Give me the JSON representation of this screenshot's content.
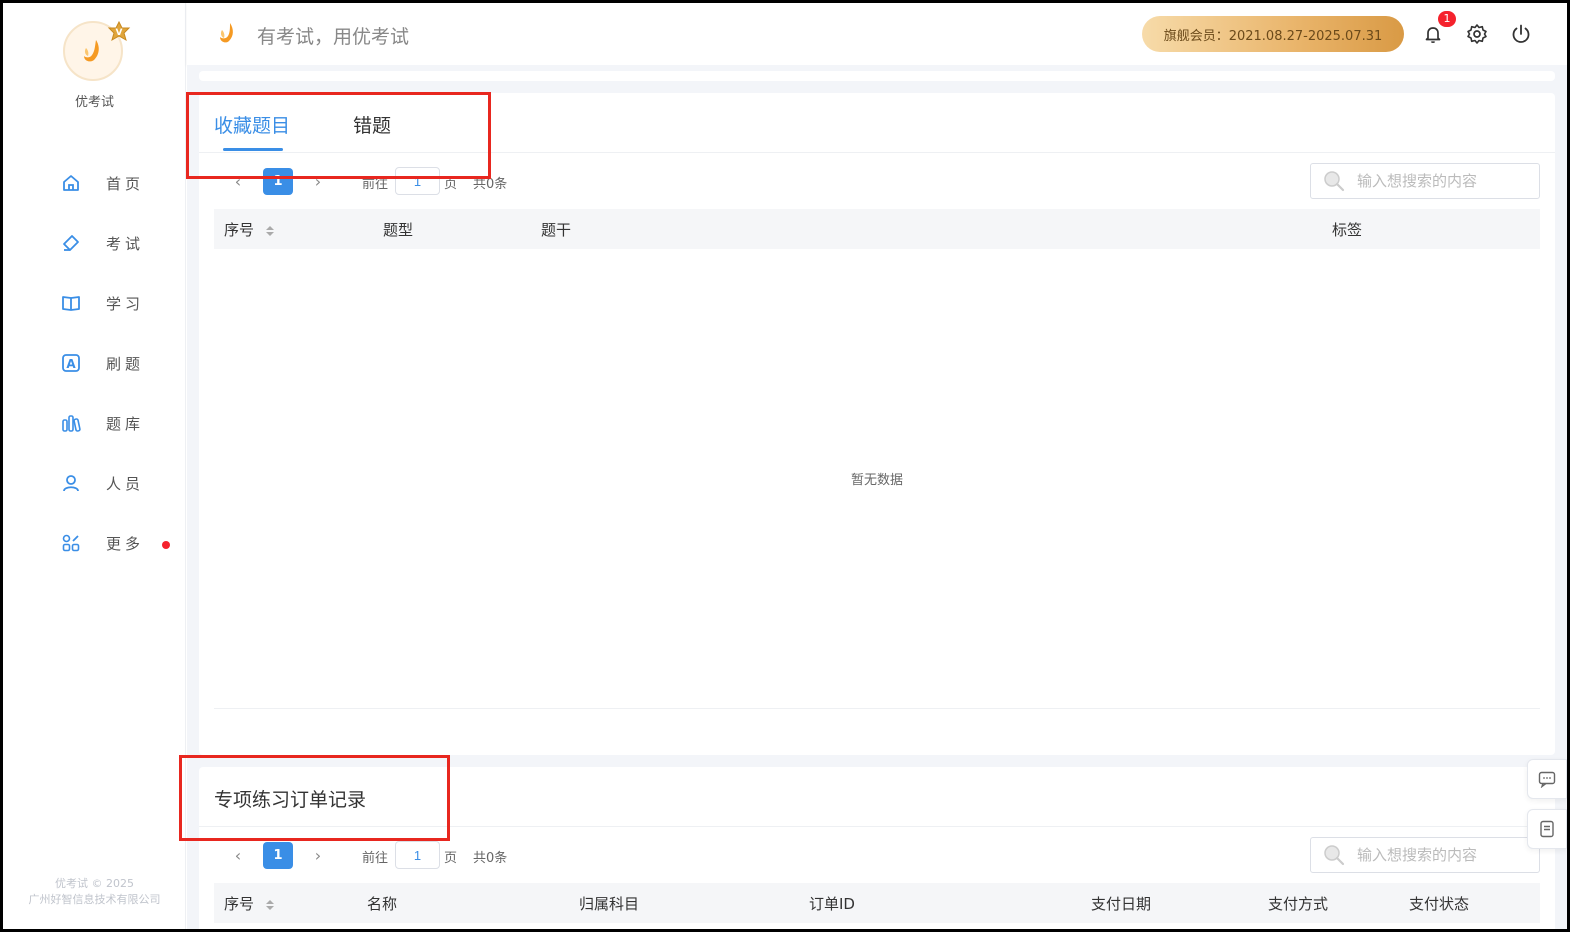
{
  "brand": {
    "name": "优考试",
    "slogan": "有考试，用优考试"
  },
  "header": {
    "member_text": "旗舰会员：2021.08.27-2025.07.31",
    "notification_count": "1"
  },
  "sidebar": {
    "items": [
      {
        "label": "首页",
        "icon": "home-icon"
      },
      {
        "label": "考试",
        "icon": "eraser-icon"
      },
      {
        "label": "学习",
        "icon": "book-icon"
      },
      {
        "label": "刷题",
        "icon": "letter-a-icon"
      },
      {
        "label": "题库",
        "icon": "bars-icon"
      },
      {
        "label": "人员",
        "icon": "user-icon"
      },
      {
        "label": "更多",
        "icon": "apps-icon"
      }
    ],
    "copyright_line1": "优考试 © 2025",
    "copyright_line2": "广州好智信息技术有限公司"
  },
  "favorites_card": {
    "tabs": [
      {
        "label": "收藏题目",
        "active": true
      },
      {
        "label": "错题",
        "active": false
      }
    ],
    "pagination": {
      "current_page": "1",
      "goto_label": "前往",
      "goto_value": "1",
      "page_unit": "页",
      "total": "共0条"
    },
    "search_placeholder": "输入想搜索的内容",
    "columns": [
      "序号",
      "题型",
      "题干",
      "标签"
    ],
    "rows": [],
    "empty_text": "暂无数据"
  },
  "orders_card": {
    "title": "专项练习订单记录",
    "pagination": {
      "current_page": "1",
      "goto_label": "前往",
      "goto_value": "1",
      "page_unit": "页",
      "total": "共0条"
    },
    "search_placeholder": "输入想搜索的内容",
    "columns": [
      "序号",
      "名称",
      "归属科目",
      "订单ID",
      "支付日期",
      "支付方式",
      "支付状态"
    ]
  },
  "colors": {
    "accent": "#3a8ee6",
    "highlight": "#e8271f",
    "member_gold": "#e9b46a"
  }
}
